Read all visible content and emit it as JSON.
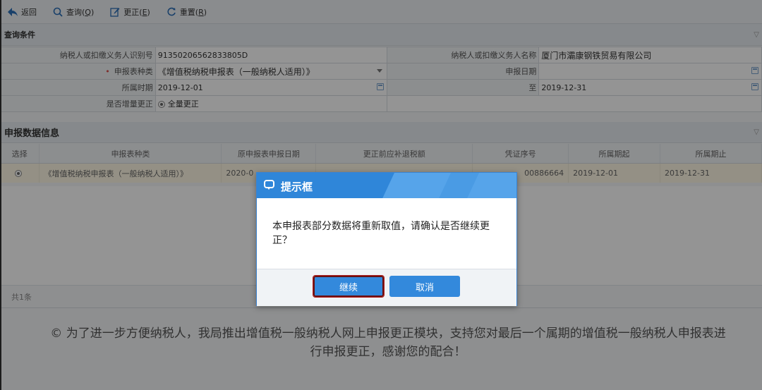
{
  "toolbar": {
    "back": {
      "label": "返回"
    },
    "query": {
      "label": "查询(",
      "key": "Q",
      "end": ")"
    },
    "modify": {
      "label": "更正(",
      "key": "E",
      "end": ")"
    },
    "reset": {
      "label": "重置(",
      "key": "R",
      "end": ")"
    }
  },
  "query_section": {
    "title": "查询条件",
    "taxpayer_id_label": "纳税人或扣缴义务人识别号",
    "taxpayer_id": "91350206562833805D",
    "taxpayer_name_label": "纳税人或扣缴义务人名称",
    "taxpayer_name": "厦门市灞康钢铁贸易有限公司",
    "form_type_label": "申报表种类",
    "form_type": "《增值税纳税申报表（一般纳税人适用）》",
    "report_date_label": "申报日期",
    "report_date": "",
    "period_label": "所属时期",
    "period_start": "2019-12-01",
    "to_label": "至",
    "period_end": "2019-12-31",
    "incremental_label": "是否增量更正",
    "incremental_option": "全量更正"
  },
  "data_section": {
    "title": "申报数据信息",
    "columns": [
      "选择",
      "申报表种类",
      "原申报表申报日期",
      "更正前应补退税额",
      "凭证序号",
      "所属期起",
      "所属期止"
    ],
    "rows": [
      {
        "form": "《增值税纳税申报表（一般纳税人适用）》",
        "orig_date": "2020-0",
        "tax": "",
        "voucher": "00886664",
        "start": "2019-12-01",
        "end": "2019-12-31"
      }
    ],
    "total": "共1条"
  },
  "notice": "© 为了进一步方便纳税人，我局推出增值税一般纳税人网上申报更正模块，支持您对最后一个属期的增值税一般纳税人申报表进行申报更正，感谢您的配合！",
  "dialog": {
    "title": "提示框",
    "message": "本申报表部分数据将重新取值，请确认是否继续更正？",
    "continue": "继续",
    "cancel": "取消"
  }
}
